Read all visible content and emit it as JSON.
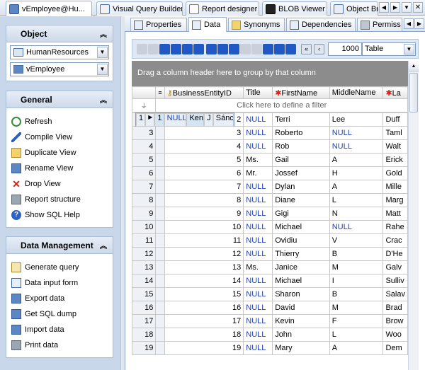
{
  "top_tabs": [
    {
      "label": "vEmployee@Hu...",
      "active": true
    },
    {
      "label": "Visual Query Builder"
    },
    {
      "label": "Report designer"
    },
    {
      "label": "BLOB Viewer"
    },
    {
      "label": "Object Br"
    }
  ],
  "left": {
    "object": {
      "title": "Object",
      "database": "HumanResources",
      "view": "vEmployee"
    },
    "general": {
      "title": "General",
      "items": [
        "Refresh",
        "Compile View",
        "Duplicate View",
        "Rename View",
        "Drop View",
        "Report structure",
        "Show SQL Help"
      ]
    },
    "data_management": {
      "title": "Data Management",
      "items": [
        "Generate query",
        "Data input form",
        "Export data",
        "Get SQL dump",
        "Import data",
        "Print data"
      ]
    }
  },
  "sub_tabs": [
    {
      "label": "Properties"
    },
    {
      "label": "Data",
      "active": true
    },
    {
      "label": "Synonyms"
    },
    {
      "label": "Dependencies"
    },
    {
      "label": "Permiss"
    }
  ],
  "toolbar": {
    "page_size": "1000",
    "view_mode": "Table"
  },
  "grid": {
    "group_hint": "Drag a column header here to group by that column",
    "filter_hint": "Click here to define a filter",
    "columns": [
      "BusinessEntityID",
      "Title",
      "FirstName",
      "MiddleName",
      "La"
    ],
    "rows": [
      [
        "1",
        "1",
        "NULL",
        "Ken",
        "J",
        "Sánc"
      ],
      [
        "2",
        "2",
        "NULL",
        "Terri",
        "Lee",
        "Duff"
      ],
      [
        "3",
        "3",
        "NULL",
        "Roberto",
        "NULL",
        "Taml"
      ],
      [
        "4",
        "4",
        "NULL",
        "Rob",
        "NULL",
        "Walt"
      ],
      [
        "5",
        "5",
        "Ms.",
        "Gail",
        "A",
        "Erick"
      ],
      [
        "6",
        "6",
        "Mr.",
        "Jossef",
        "H",
        "Gold"
      ],
      [
        "7",
        "7",
        "NULL",
        "Dylan",
        "A",
        "Mille"
      ],
      [
        "8",
        "8",
        "NULL",
        "Diane",
        "L",
        "Marg"
      ],
      [
        "9",
        "9",
        "NULL",
        "Gigi",
        "N",
        "Matt"
      ],
      [
        "10",
        "10",
        "NULL",
        "Michael",
        "NULL",
        "Rahe"
      ],
      [
        "11",
        "11",
        "NULL",
        "Ovidiu",
        "V",
        "Crac"
      ],
      [
        "12",
        "12",
        "NULL",
        "Thierry",
        "B",
        "D'He"
      ],
      [
        "13",
        "13",
        "Ms.",
        "Janice",
        "M",
        "Galv"
      ],
      [
        "14",
        "14",
        "NULL",
        "Michael",
        "I",
        "Sulliv"
      ],
      [
        "15",
        "15",
        "NULL",
        "Sharon",
        "B",
        "Salav"
      ],
      [
        "16",
        "16",
        "NULL",
        "David",
        "M",
        "Brad"
      ],
      [
        "17",
        "17",
        "NULL",
        "Kevin",
        "F",
        "Brow"
      ],
      [
        "18",
        "18",
        "NULL",
        "John",
        "L",
        "Woo"
      ],
      [
        "19",
        "19",
        "NULL",
        "Mary",
        "A",
        "Dem"
      ]
    ]
  }
}
